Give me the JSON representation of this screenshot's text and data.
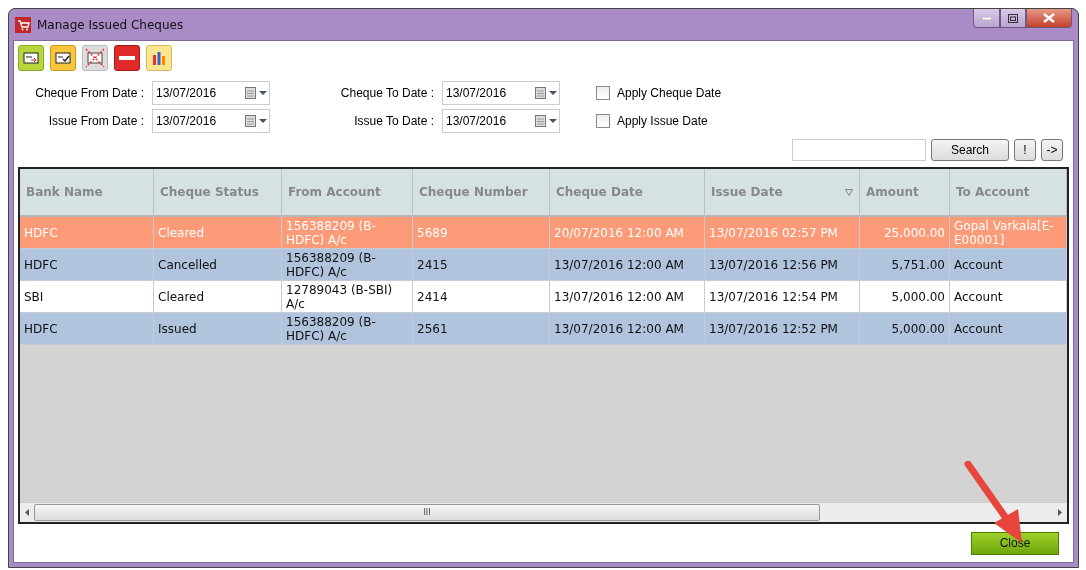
{
  "window": {
    "title": "Manage Issued Cheques"
  },
  "toolbar": [
    {
      "kind": "issue"
    },
    {
      "kind": "clear"
    },
    {
      "kind": "cancel"
    },
    {
      "kind": "delete"
    },
    {
      "kind": "report"
    }
  ],
  "filters": [
    {
      "label": "Cheque From Date :",
      "value": "13/07/2016"
    },
    {
      "label": "Cheque To Date :",
      "value": "13/07/2016"
    },
    {
      "label": "Issue From Date :",
      "value": "13/07/2016"
    },
    {
      "label": "Issue To Date :",
      "value": "13/07/2016"
    }
  ],
  "checkboxes": [
    {
      "label": "Apply Cheque Date",
      "checked": false
    },
    {
      "label": "Apply Issue Date",
      "checked": false
    }
  ],
  "search": {
    "button": "Search",
    "extra_buttons": [
      "!",
      "->"
    ]
  },
  "table": {
    "columns": [
      {
        "label": "Bank Name",
        "sorted": false
      },
      {
        "label": "Cheque Status",
        "sorted": false
      },
      {
        "label": "From Account",
        "sorted": false
      },
      {
        "label": "Cheque Number",
        "sorted": false
      },
      {
        "label": "Cheque Date",
        "sorted": false
      },
      {
        "label": "Issue Date",
        "sorted": true
      },
      {
        "label": "Amount",
        "sorted": false
      },
      {
        "label": "To Account",
        "sorted": false
      }
    ],
    "rows": [
      {
        "selected": true,
        "cells": [
          "HDFC",
          "Cleared",
          "156388209 (B-HDFC) A/c",
          "5689",
          "20/07/2016 12:00 AM",
          "13/07/2016 02:57 PM",
          "25,000.00",
          "Gopal Varkala[E-E00001]"
        ]
      },
      {
        "selected": false,
        "cells": [
          "HDFC",
          "Cancelled",
          "156388209 (B-HDFC) A/c",
          "2415",
          "13/07/2016 12:00 AM",
          "13/07/2016 12:56 PM",
          "5,751.00",
          "Account"
        ]
      },
      {
        "selected": false,
        "cells": [
          "SBI",
          "Cleared",
          "12789043 (B-SBI) A/c",
          "2414",
          "13/07/2016 12:00 AM",
          "13/07/2016 12:54 PM",
          "5,000.00",
          "Account"
        ]
      },
      {
        "selected": false,
        "cells": [
          "HDFC",
          "Issued",
          "156388209 (B-HDFC) A/c",
          "2561",
          "13/07/2016 12:00 AM",
          "13/07/2016 12:52 PM",
          "5,000.00",
          "Account"
        ]
      }
    ],
    "scrollbar_grip": "III"
  },
  "footer": {
    "close_button": "Close"
  }
}
